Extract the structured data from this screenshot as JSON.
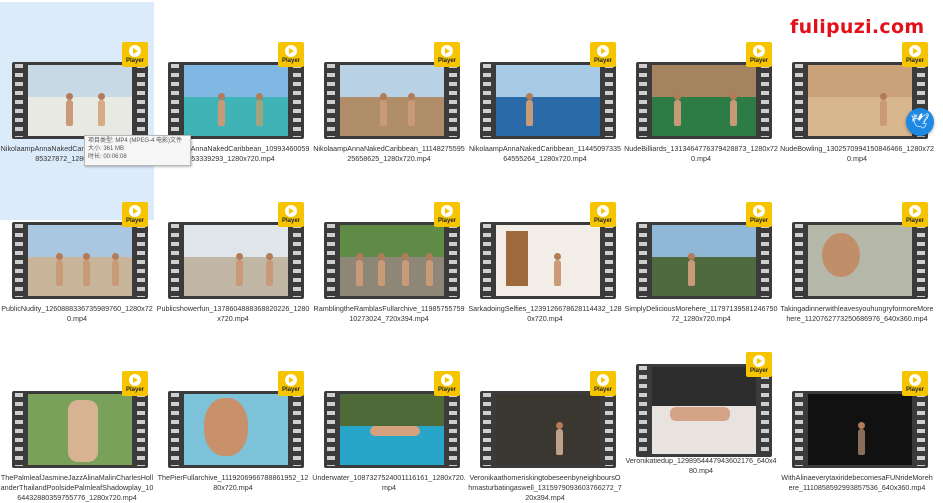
{
  "watermark": "fulipuzi.com",
  "badge_label": "Player",
  "tooltip": {
    "line1": "项目类型: MP4 (MPEG-4 电影)文件",
    "line2": "大小: 361 MB",
    "line3": "时长: 00:06:08"
  },
  "floating_icon": "bird-icon",
  "colors": {
    "badge": "#f6c500",
    "selection": "#dcebfa",
    "watermark": "#e3101a"
  },
  "files": [
    {
      "name": "NikolaampAnnaNakedCaribbean_1079698464085327872_1280x720.mp4",
      "selected": true
    },
    {
      "name": "NikolaampAnnaNakedCaribbean_1099346005953339293_1280x720.mp4"
    },
    {
      "name": "NikolaampAnnaNakedCaribbean_1114827559525658625_1280x720.mp4"
    },
    {
      "name": "NikolaampAnnaNakedCaribbean_1144509733564555264_1280x720.mp4"
    },
    {
      "name": "NudeBilliards_1313464776379428873_1280x720.mp4"
    },
    {
      "name": "NudeBowling_1302570994150846466_1280x720.mp4"
    },
    {
      "name": "PublicNudity_1260888336735989760_1280x720.mp4"
    },
    {
      "name": "Publicshowerfun_1378604888368820226_1280x720.mp4"
    },
    {
      "name": "RamblingtheRamblasFullarchive_1198575575910273024_720x394.mp4"
    },
    {
      "name": "SarkadoingSelfies_1239126678628114432_1280x720.mp4"
    },
    {
      "name": "SimplyDeliciousMorehere_1179713958124675072_1280x720.mp4"
    },
    {
      "name": "TakingadinnerwithleavesyouhungryformoreMorehere_1120762773250686976_640x360.mp4"
    },
    {
      "name": "ThePalmleafJasmineJazzAlinaMalinCharlesHollanderThailandPoolsidePalmleafShadowplay_1064432880359755776_1280x720.mp4"
    },
    {
      "name": "ThePierFullarchive_1119206966788861952_1280x720.mp4"
    },
    {
      "name": "Underwater_1087327524001116161_1280x720.mp4"
    },
    {
      "name": "VeronikaathomeriskingtobeseenbyneighboursOhmasturbatingaswell_1315979093603766272_720x394.mp4"
    },
    {
      "name": "Veronikatiedup_1298954447943602176_640x480.mp4"
    },
    {
      "name": "WithAlinaeverytaxiridebecomesaFUNrideMorehere_1110858592993857536_640x360.mp4"
    }
  ]
}
